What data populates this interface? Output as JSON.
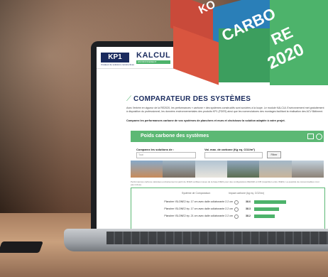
{
  "site": {
    "logo": "KP1",
    "logo_sub": "Créateur de solutions constructives",
    "kalcul": "KALCUL",
    "kalcul_sub": "ENVIRONNEMENT"
  },
  "page": {
    "title": "COMPARATEUR DES SYSTÈMES",
    "intro": "Avec l'entrée en vigueur de la RE2020, les performances « carbone » des systèmes constructifs sont scrutées à la loupe. Le module KALCUL Environnement met gratuitement à disposition du professionnel, les données environnementales des produits KP1 (FDES) ainsi que les nomenclatures des montages facilitant la réalisation des ACV Bâtiment.",
    "intro_bold": "Comparez les performances carbone de vos systèmes de planchers et murs et choisissez la solution adaptée à votre projet."
  },
  "section": {
    "title": "Poids carbone des systèmes"
  },
  "filters": {
    "compare_label": "Comparez les solutions de :",
    "compare_value": "Tout",
    "max_label": "Val. max. de carbone (Kg eq. CO2/m²)",
    "filter_button": "Filtrer"
  },
  "note": "Performances carbone calculées exclusivement à partir de FDES vérifiées issues de la base INIES pour des configurations RE2020 et ICB (répartition entre INIES). La quantité de consommables n'est pas incluse.",
  "table": {
    "col_compare": "Système de Comparaison",
    "col_impact": "Impact carbone (kg eq. CO2/m²)",
    "rows": [
      {
        "label": "Plancher ISLONE2 ép. 17 cm avec dalle collaborante 2.2 cm",
        "value": "38.6",
        "pct": 0.75
      },
      {
        "label": "Plancher ISLONE2 ép. 17 cm avec dalle collaborante 2.2 cm",
        "value": "38.3",
        "pct": 0.58
      },
      {
        "label": "Plancher ISLONE2 ép. 21 cm avec dalle collaborante 2.2 cm",
        "value": "38.2",
        "pct": 0.48
      }
    ]
  },
  "cube_text": {
    "a": "KO",
    "b": "CARBO",
    "c": "RE",
    "d": "2020"
  },
  "colors": {
    "brand_green": "#5cb874",
    "brand_navy": "#1a2b5e"
  }
}
